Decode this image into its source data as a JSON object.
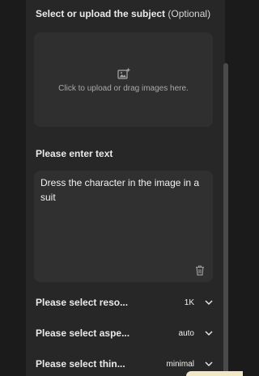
{
  "upload_section": {
    "title": "Select or upload the subject",
    "optional": "(Optional)",
    "hint": "Click to upload or drag images here.",
    "icon": "add-image-icon"
  },
  "text_section": {
    "title": "Please enter text",
    "value": "Dress the character in the image in a suit",
    "delete_icon": "trash-icon"
  },
  "selects": [
    {
      "label": "Please select reso...",
      "value": "1K"
    },
    {
      "label": "Please select aspe...",
      "value": "auto"
    },
    {
      "label": "Please select thin...",
      "value": "minimal"
    }
  ],
  "colors": {
    "background": "#1b1b1b",
    "panel": "#272727",
    "input_bg": "#303030",
    "text": "#eaeaea"
  }
}
